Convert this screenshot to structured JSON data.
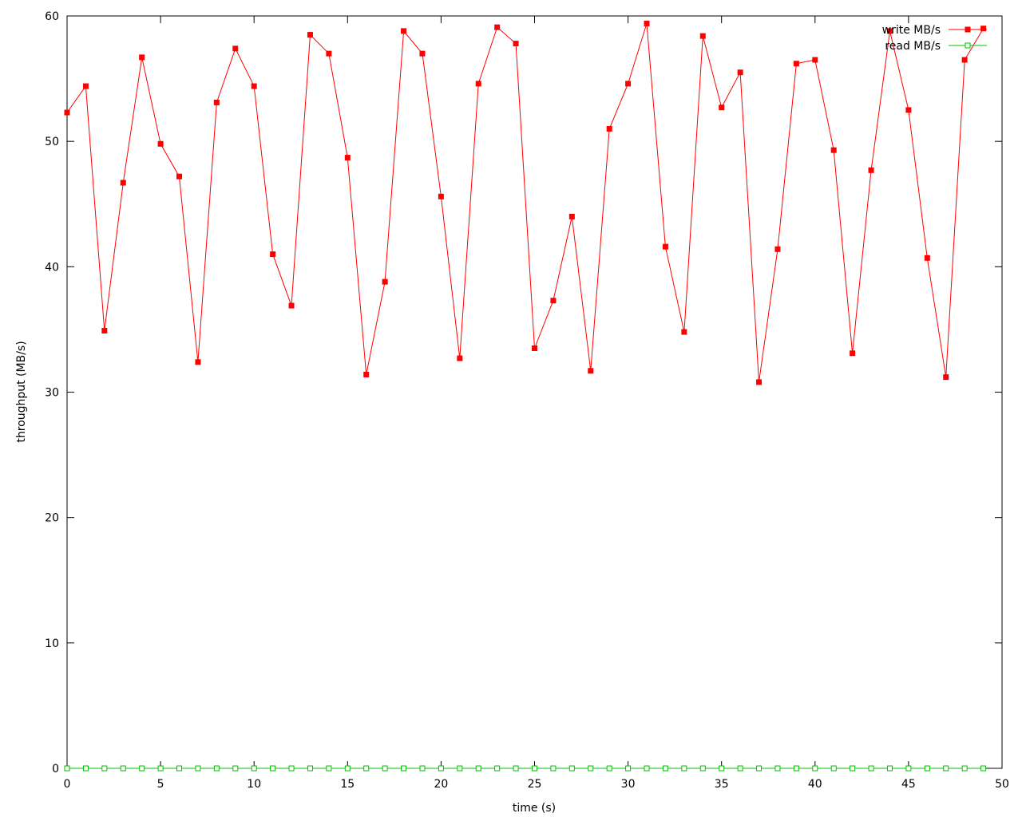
{
  "chart_data": {
    "type": "line",
    "xlabel": "time (s)",
    "ylabel": "throughput (MB/s)",
    "xlim": [
      0,
      50
    ],
    "ylim": [
      0,
      60
    ],
    "xticks": [
      0,
      5,
      10,
      15,
      20,
      25,
      30,
      35,
      40,
      45,
      50
    ],
    "yticks": [
      0,
      10,
      20,
      30,
      40,
      50,
      60
    ],
    "grid": false,
    "legend_position": "top-right",
    "x": [
      0,
      1,
      2,
      3,
      4,
      5,
      6,
      7,
      8,
      9,
      10,
      11,
      12,
      13,
      14,
      15,
      16,
      17,
      18,
      19,
      20,
      21,
      22,
      23,
      24,
      25,
      26,
      27,
      28,
      29,
      30,
      31,
      32,
      33,
      34,
      35,
      36,
      37,
      38,
      39,
      40,
      41,
      42,
      43,
      44,
      45,
      46,
      47,
      48,
      49
    ],
    "series": [
      {
        "name": "write MB/s",
        "color": "#ff0000",
        "marker": "filled-square",
        "values": [
          52.3,
          54.4,
          34.9,
          46.7,
          56.7,
          49.8,
          47.2,
          32.4,
          53.1,
          57.4,
          54.4,
          41.0,
          36.9,
          58.5,
          57.0,
          48.7,
          31.4,
          38.8,
          58.8,
          57.0,
          45.6,
          32.7,
          54.6,
          59.1,
          57.8,
          33.5,
          37.3,
          44.0,
          31.7,
          51.0,
          54.6,
          59.4,
          41.6,
          34.8,
          58.4,
          52.7,
          55.5,
          30.8,
          41.4,
          56.2,
          56.5,
          49.3,
          33.1,
          47.7,
          58.8,
          52.5,
          40.7,
          31.2,
          56.5,
          59.0
        ]
      },
      {
        "name": "read MB/s",
        "color": "#00c000",
        "marker": "open-square",
        "values": [
          0,
          0,
          0,
          0,
          0,
          0,
          0,
          0,
          0,
          0,
          0,
          0,
          0,
          0,
          0,
          0,
          0,
          0,
          0,
          0,
          0,
          0,
          0,
          0,
          0,
          0,
          0,
          0,
          0,
          0,
          0,
          0,
          0,
          0,
          0,
          0,
          0,
          0,
          0,
          0,
          0,
          0,
          0,
          0,
          0,
          0,
          0,
          0,
          0,
          0
        ]
      }
    ]
  }
}
